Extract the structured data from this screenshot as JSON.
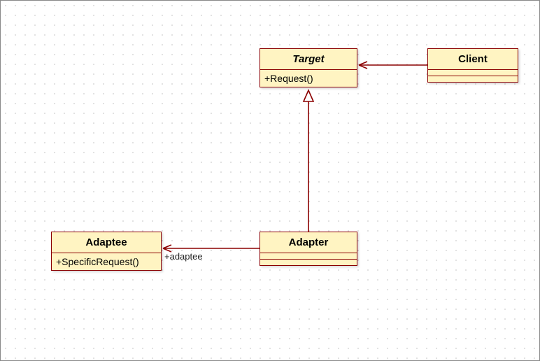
{
  "diagram": {
    "type": "uml-class-diagram",
    "pattern": "Adapter",
    "classes": {
      "target": {
        "name": "Target",
        "italic": true,
        "operations": [
          "+Request()"
        ],
        "attributes": []
      },
      "client": {
        "name": "Client",
        "italic": false,
        "operations": [],
        "attributes": []
      },
      "adapter": {
        "name": "Adapter",
        "italic": false,
        "operations": [],
        "attributes": []
      },
      "adaptee": {
        "name": "Adaptee",
        "italic": false,
        "operations": [
          "+SpecificRequest()"
        ],
        "attributes": []
      }
    },
    "relationships": [
      {
        "from": "client",
        "to": "target",
        "type": "association",
        "role_to": ""
      },
      {
        "from": "adapter",
        "to": "target",
        "type": "generalization",
        "role_to": ""
      },
      {
        "from": "adapter",
        "to": "adaptee",
        "type": "association",
        "role_to": "+adaptee"
      }
    ],
    "labels": {
      "adaptee_role": "+adaptee"
    },
    "colors": {
      "box_fill": "#fff4c2",
      "box_border": "#8b0000",
      "line": "#8b0000"
    }
  }
}
